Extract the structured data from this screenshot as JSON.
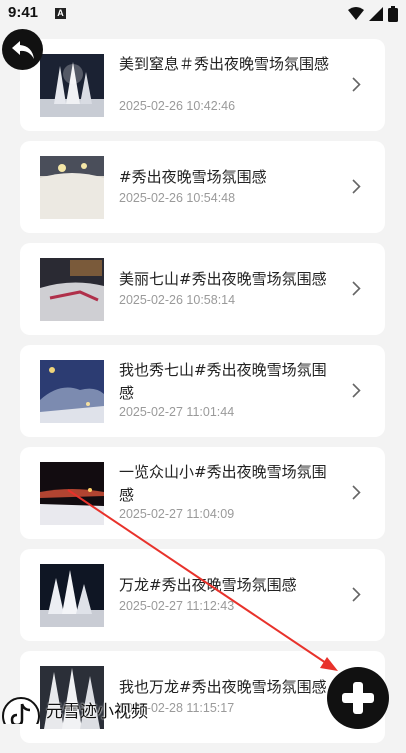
{
  "status_bar": {
    "time": "9:41",
    "notification_letter": "A"
  },
  "items": [
    {
      "title": "美到窒息＃秀出夜晚雪场氛围感",
      "date": "2025-02-26 10:42:46"
    },
    {
      "title": "#秀出夜晚雪场氛围感",
      "date": "2025-02-26 10:54:48"
    },
    {
      "title": "美丽七山#秀出夜晚雪场氛围感",
      "date": "2025-02-26 10:58:14"
    },
    {
      "title": "我也秀七山#秀出夜晚雪场氛围感",
      "date": "2025-02-27 11:01:44"
    },
    {
      "title": "一览众山小#秀出夜晚雪场氛围感",
      "date": "2025-02-27 11:04:09"
    },
    {
      "title": "万龙#秀出夜晚雪场氛围感",
      "date": "2025-02-27 11:12:43"
    },
    {
      "title": "我也万龙#秀出夜晚雪场氛围感",
      "date": "2025-02-28 11:15:17"
    }
  ],
  "watermark": {
    "text": "元雪迹小视频"
  },
  "colors": {
    "background": "#f3f3f3",
    "card": "#ffffff",
    "accent_arrow": "#e8322b",
    "button": "#111111"
  }
}
